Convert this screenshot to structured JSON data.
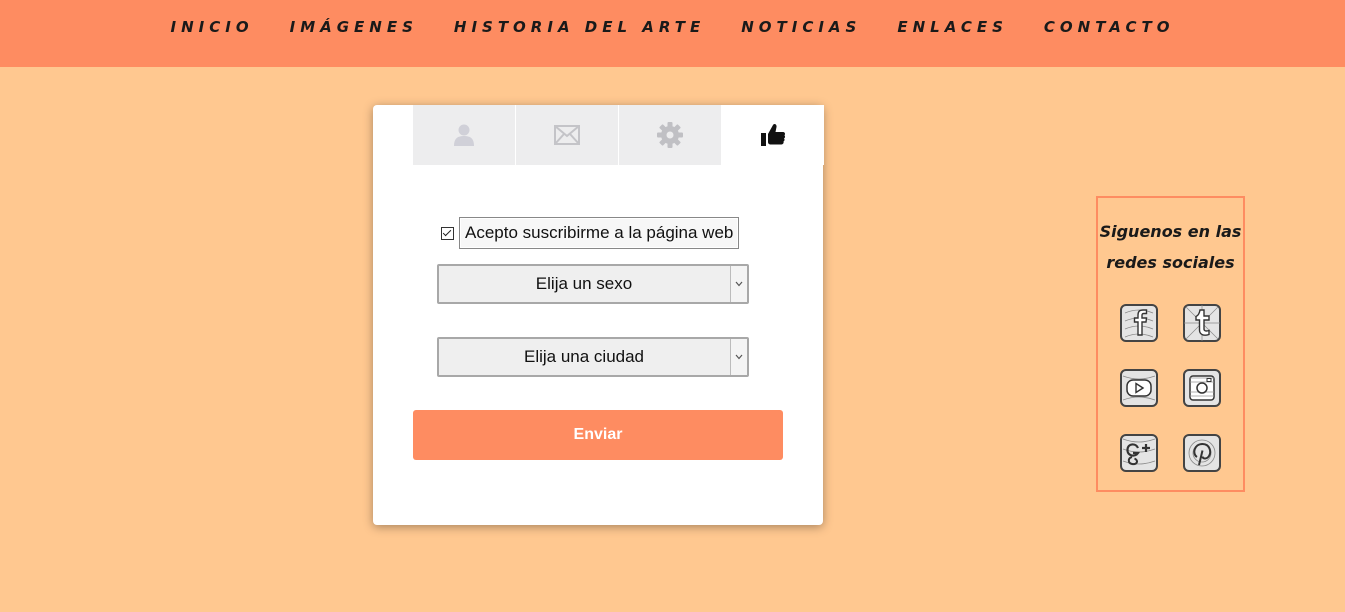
{
  "nav": {
    "items": [
      "INICIO",
      "IMÁGENES",
      "HISTORIA DEL ARTE",
      "NOTICIAS",
      "ENLACES",
      "CONTACTO"
    ]
  },
  "tabs": [
    {
      "icon": "user-icon",
      "active": false
    },
    {
      "icon": "envelope-icon",
      "active": false
    },
    {
      "icon": "gear-icon",
      "active": false
    },
    {
      "icon": "thumbs-up-icon",
      "active": true
    }
  ],
  "form": {
    "subscribe_label": "Acepto suscribirme a la página web",
    "subscribe_checked": true,
    "sex_select": "Elija un sexo",
    "city_select": "Elija una ciudad",
    "submit_label": "Enviar"
  },
  "social": {
    "title_line1": "Siguenos en las",
    "title_line2": "redes sociales",
    "icons": [
      "facebook-icon",
      "tumblr-icon",
      "youtube-icon",
      "instagram-icon",
      "google-plus-icon",
      "pinterest-icon"
    ]
  },
  "colors": {
    "background": "#ffc890",
    "accent": "#fe8c61",
    "card": "#ffffff",
    "tab_inactive": "#ededee"
  }
}
